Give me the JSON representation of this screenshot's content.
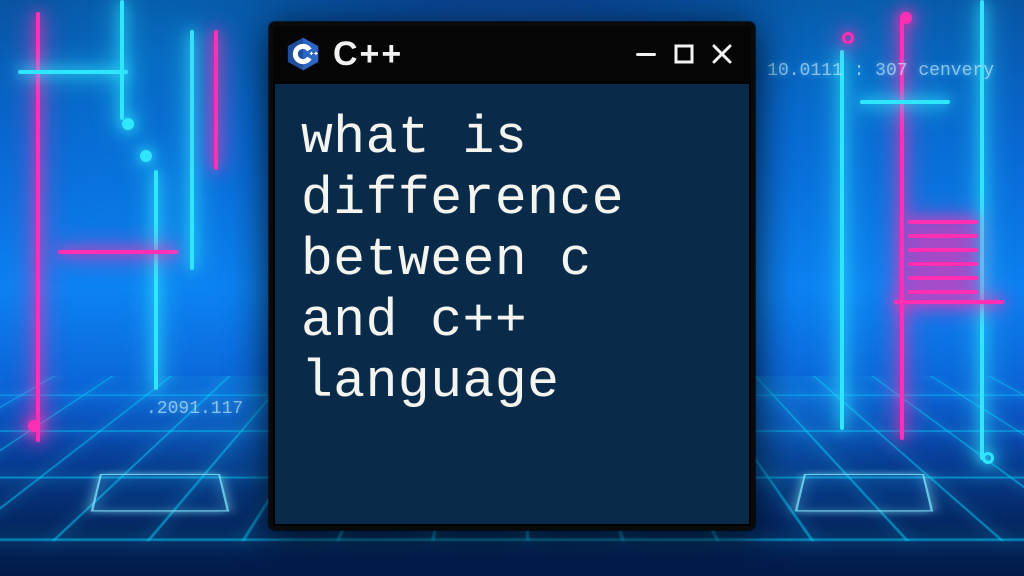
{
  "window": {
    "title": "C++",
    "icon_name": "cpp-icon",
    "controls": {
      "minimize": "−",
      "maximize": "□",
      "close": "×"
    }
  },
  "content": {
    "text": "what is\ndifference\nbetween c\nand c++\nlanguage"
  },
  "background": {
    "labels": {
      "left_number": ".2091.117",
      "right_header": "10.0111 : 307  cenvery"
    }
  },
  "colors": {
    "cyan": "#2fe6ff",
    "magenta": "#ff2fb3",
    "window_bg": "#0a2a4a",
    "window_border": "#0a0a0a"
  }
}
